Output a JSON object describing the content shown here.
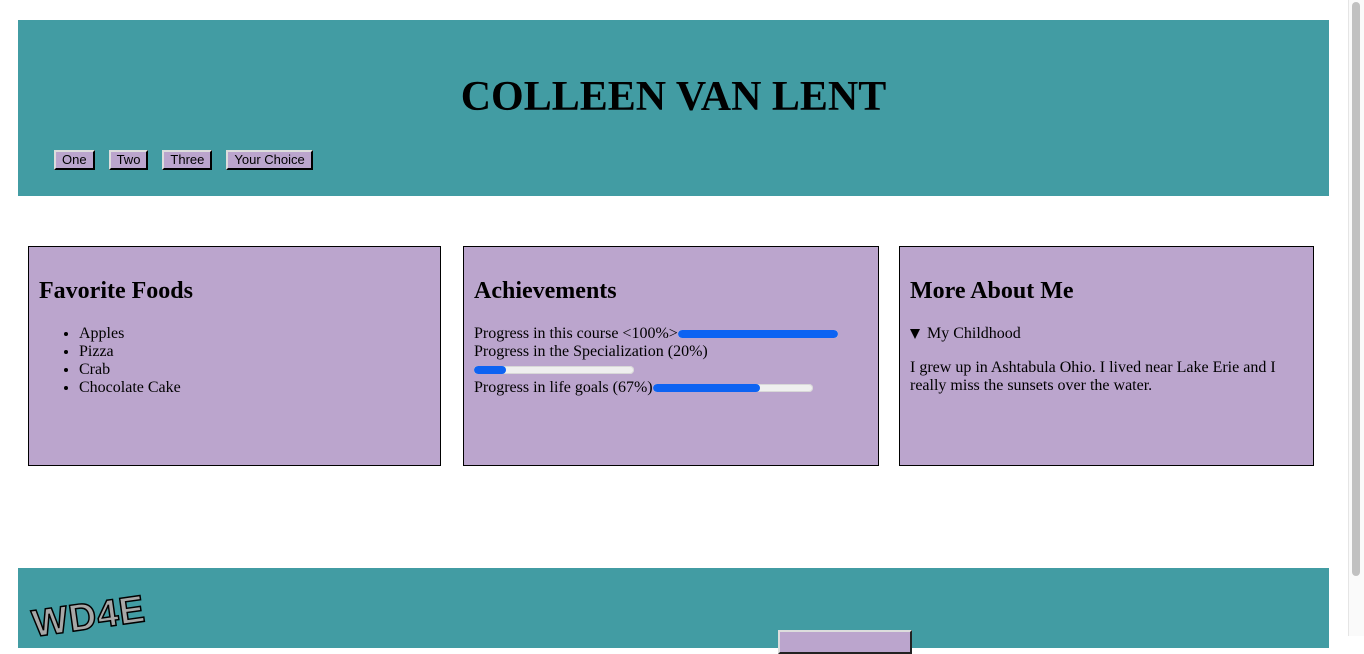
{
  "header": {
    "title": "COLLEEN VAN LENT",
    "nav": [
      "One",
      "Two",
      "Three",
      "Your Choice"
    ]
  },
  "foods": {
    "heading": "Favorite Foods",
    "items": [
      "Apples",
      "Pizza",
      "Crab",
      "Chocolate Cake"
    ]
  },
  "achievements": {
    "heading": "Achievements",
    "rows": [
      {
        "label": "Progress in this course <100%>",
        "value": 1.0
      },
      {
        "label": "Progress in the Specialization (20%)",
        "value": 0.2
      },
      {
        "label": "Progress in life goals (67%)",
        "value": 0.67
      }
    ]
  },
  "about": {
    "heading": "More About Me",
    "summary": "My Childhood",
    "body": "I grew up in Ashtabula Ohio. I lived near Lake Erie and I really miss the sunsets over the water."
  },
  "footer": {
    "logo_text": "WD4E"
  },
  "colors": {
    "teal": "#429ca3",
    "lavender": "#bba5cd",
    "progress": "#0d63f2"
  }
}
